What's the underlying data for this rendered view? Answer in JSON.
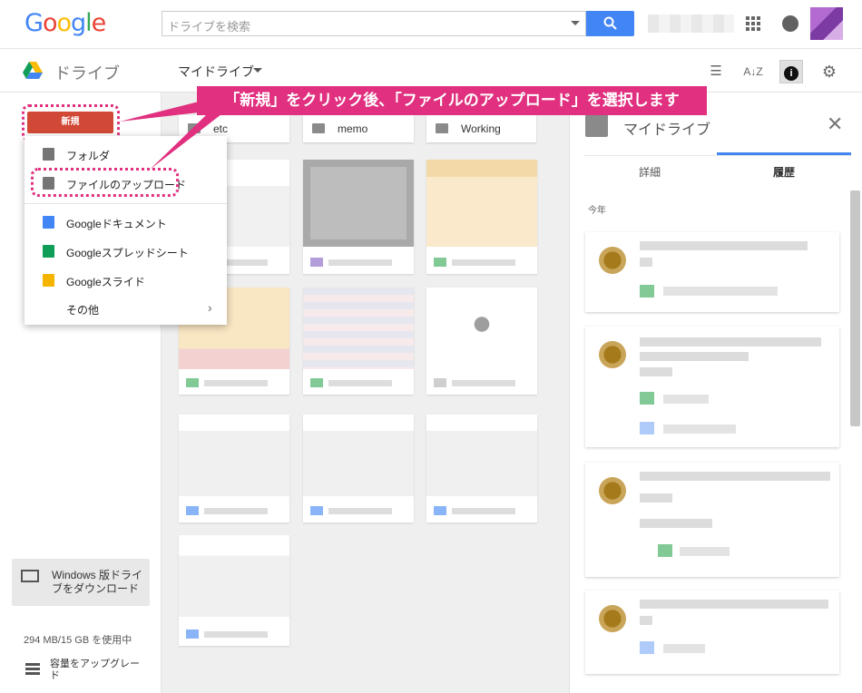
{
  "header": {
    "search_placeholder": "ドライブを検索"
  },
  "subbar": {
    "app_name": "ドライブ",
    "location": "マイドライブ"
  },
  "sidebar": {
    "new_button": "新規",
    "download_line1": "Windows 版ドライ",
    "download_line2": "ブをダウンロード",
    "storage_text": "294 MB/15 GB を使用中",
    "upgrade_text": "容量をアップグレード"
  },
  "menu": {
    "items": [
      {
        "label": "フォルダ",
        "icon": "new-folder-icon"
      },
      {
        "label": "ファイルのアップロード",
        "icon": "file-upload-icon"
      },
      {
        "label": "Googleドキュメント",
        "icon": "docs-icon"
      },
      {
        "label": "Googleスプレッドシート",
        "icon": "sheets-icon"
      },
      {
        "label": "Googleスライド",
        "icon": "slides-icon"
      },
      {
        "label": "その他",
        "icon": "chevron-right-icon"
      }
    ]
  },
  "folders": [
    "etc",
    "memo",
    "Working"
  ],
  "callout": {
    "text": "「新規」をクリック後、「ファイルのアップロード」を選択します"
  },
  "details": {
    "title": "マイドライブ",
    "tabs": [
      "詳細",
      "履歴"
    ],
    "active_tab": "履歴",
    "section_label": "今年"
  },
  "colors": {
    "accent": "#e0307f",
    "new_button": "#d14836",
    "search_button": "#4285f4",
    "docs": "#4285f4",
    "sheets": "#0f9d58",
    "slides": "#f4b400"
  }
}
